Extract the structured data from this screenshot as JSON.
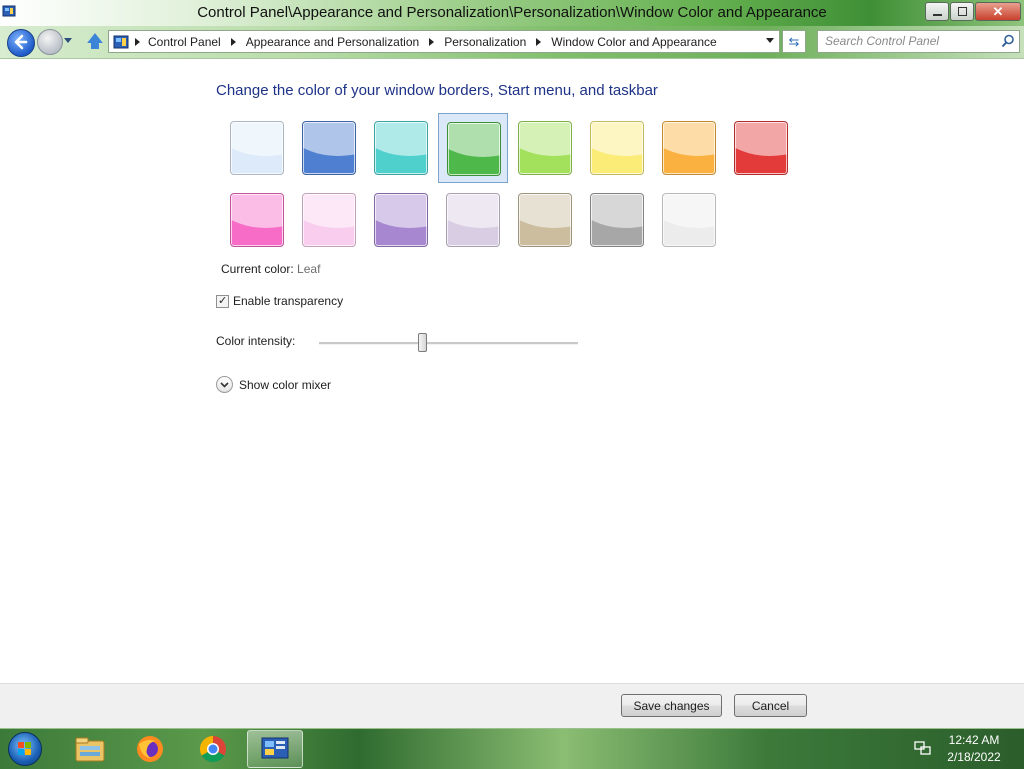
{
  "window": {
    "title": "Control Panel\\Appearance and Personalization\\Personalization\\Window Color and Appearance"
  },
  "navigation": {
    "breadcrumbs": [
      "Control Panel",
      "Appearance and Personalization",
      "Personalization",
      "Window Color and Appearance"
    ],
    "search_placeholder": "Search Control Panel"
  },
  "content": {
    "heading": "Change the color of your window borders, Start menu, and taskbar",
    "swatches": [
      {
        "color": "#dceaf9",
        "selected": false
      },
      {
        "color": "#4f7fd0",
        "selected": false
      },
      {
        "color": "#4fd0cd",
        "selected": false
      },
      {
        "color": "#4fb84a",
        "selected": true
      },
      {
        "color": "#a3e05c",
        "selected": false
      },
      {
        "color": "#fbec78",
        "selected": false
      },
      {
        "color": "#fbb13f",
        "selected": false
      },
      {
        "color": "#e33a3a",
        "selected": false
      },
      {
        "color": "#f76cc6",
        "selected": false
      },
      {
        "color": "#f8cdee",
        "selected": false
      },
      {
        "color": "#a787cf",
        "selected": false
      },
      {
        "color": "#d8cde2",
        "selected": false
      },
      {
        "color": "#cbbd9e",
        "selected": false
      },
      {
        "color": "#a7a7a7",
        "selected": false
      },
      {
        "color": "#ececec",
        "selected": false
      }
    ],
    "current_color_label": "Current color:",
    "current_color_value": "Leaf",
    "transparency_label": "Enable transparency",
    "transparency_checked": true,
    "intensity_label": "Color intensity:",
    "intensity_level": 0.4,
    "mixer_label": "Show color mixer"
  },
  "footer": {
    "save_label": "Save changes",
    "cancel_label": "Cancel"
  },
  "taskbar": {
    "items": [
      "windows-explorer-icon",
      "firefox-icon",
      "chrome-icon",
      "control-panel-icon"
    ],
    "time": "12:42 AM",
    "date": "2/18/2022"
  }
}
